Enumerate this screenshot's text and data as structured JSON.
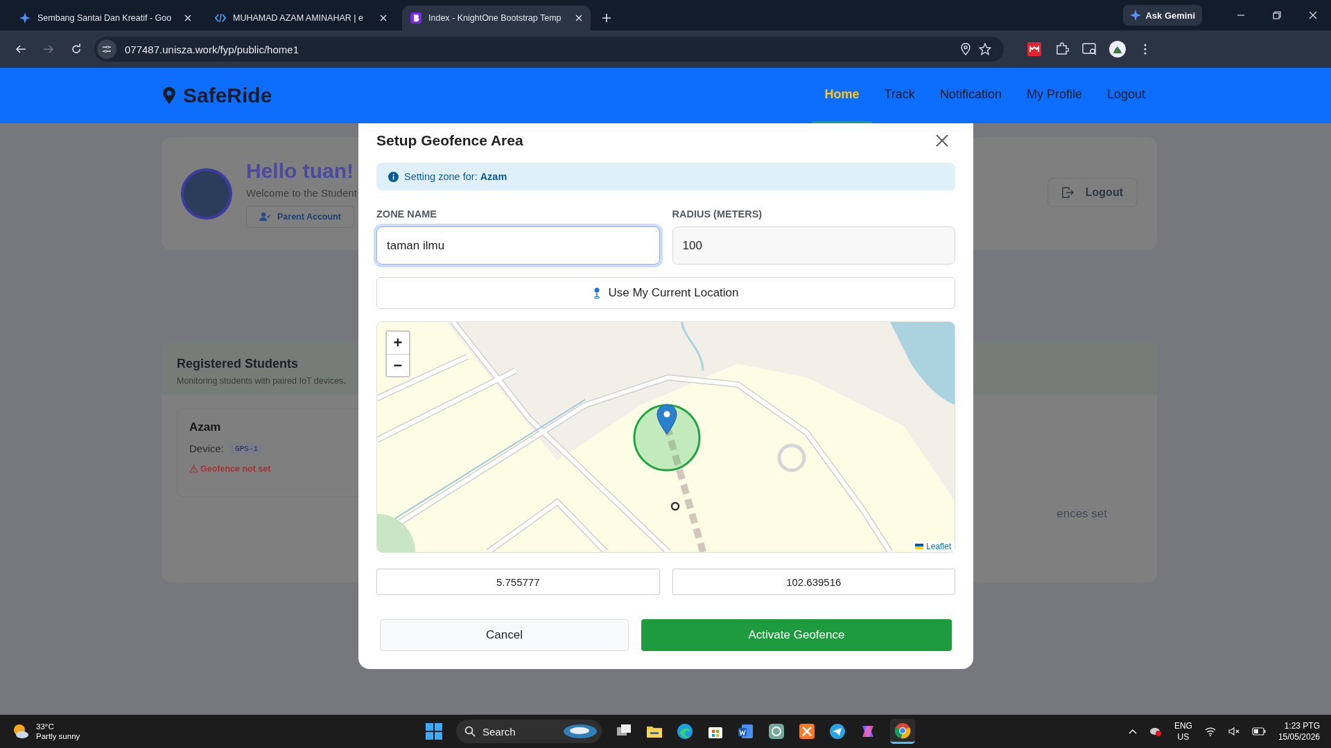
{
  "browser": {
    "tabs": [
      {
        "title": "Sembang Santai Dan Kreatif - Goo",
        "kind": "gemini",
        "selected": false
      },
      {
        "title": "MUHAMAD AZAM AMINAHAR | e",
        "kind": "code",
        "selected": false
      },
      {
        "title": "Index - KnightOne Bootstrap Temp",
        "kind": "bootstrap",
        "selected": true
      }
    ],
    "ask_button": "Ask Gemini",
    "url": "077487.unisza.work/fyp/public/home1"
  },
  "navbar": {
    "brand": "SafeRide",
    "links": [
      {
        "label": "Home",
        "selected": true
      },
      {
        "label": "Track",
        "selected": false
      },
      {
        "label": "Notification",
        "selected": false
      },
      {
        "label": "My Profile",
        "selected": false
      },
      {
        "label": "Logout",
        "selected": false
      }
    ]
  },
  "profile_card": {
    "greeting": "Hello tuan!",
    "welcome": "Welcome to the Student",
    "account_button": "Parent Account",
    "logout_button": "Logout"
  },
  "students_panel": {
    "title": "Registered Students",
    "subtitle": "Monitoring students with paired IoT devices.",
    "students": [
      {
        "name": "Azam",
        "device_label": "Device:",
        "device": "GPS-1",
        "geofence_status": "Geofence not set"
      }
    ],
    "partial_text": "ences set"
  },
  "modal": {
    "title": "Setup Geofence Area",
    "info": "Setting zone for: **Azam**",
    "fields": [
      {
        "label": "ZONE NAME",
        "value": "taman ilmu",
        "focused": true
      },
      {
        "label": "RADIUS (METERS)",
        "value": "100",
        "focused": false
      }
    ],
    "location_button": "Use My Current Location",
    "map": {
      "zoom_in": "+",
      "zoom_out": "−",
      "attribution": "Leaflet"
    },
    "coordinates": [
      {
        "value": "5.755777"
      },
      {
        "value": "102.639516"
      }
    ],
    "cancel_button": "Cancel",
    "submit_button": "Activate Geofence"
  },
  "taskbar": {
    "temperature": "33°C",
    "weather": "Partly sunny",
    "search_placeholder": "Search",
    "language": "ENG",
    "region": "US",
    "time": "1:23 PTG",
    "date": "15/05/2026"
  }
}
